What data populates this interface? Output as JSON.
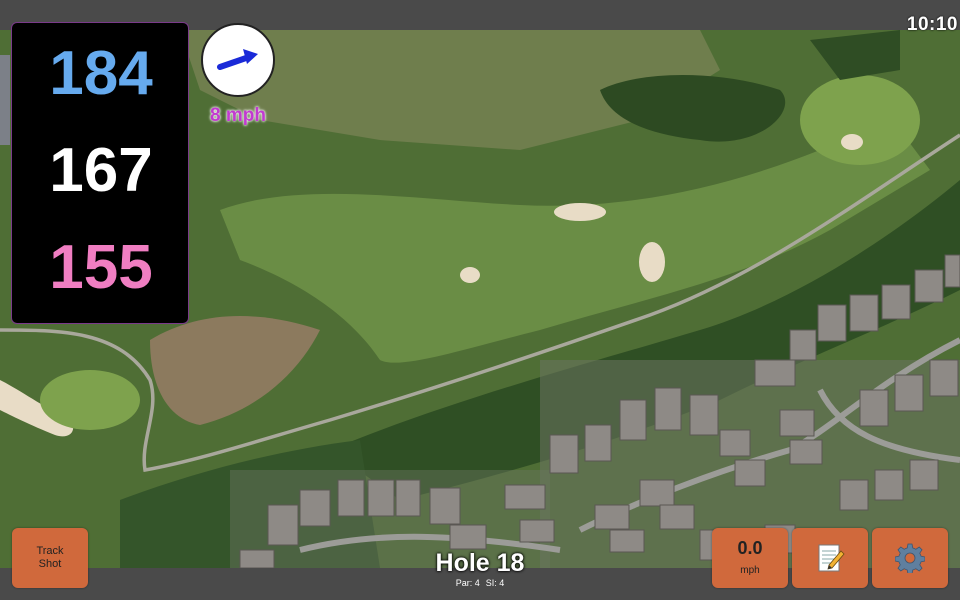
{
  "status_bar": {
    "time": "10:10"
  },
  "distances": {
    "back": "184",
    "center": "167",
    "front": "155"
  },
  "wind": {
    "speed": "8 mph",
    "direction_icon": "arrow-icon"
  },
  "hole": {
    "title": "Hole 18",
    "par": "Par: 4",
    "stroke_index": "SI: 4"
  },
  "buttons": {
    "track_shot_line1": "Track",
    "track_shot_line2": "Shot",
    "shot_speed_value": "0.0",
    "shot_speed_unit": "mph",
    "scorecard_icon": "notepad-icon",
    "settings_icon": "gear-icon"
  },
  "colors": {
    "back_distance": "#66aaee",
    "center_distance": "#ffffff",
    "front_distance": "#f07ec2",
    "button": "#d0693c",
    "wind_text": "#c23ad0"
  }
}
